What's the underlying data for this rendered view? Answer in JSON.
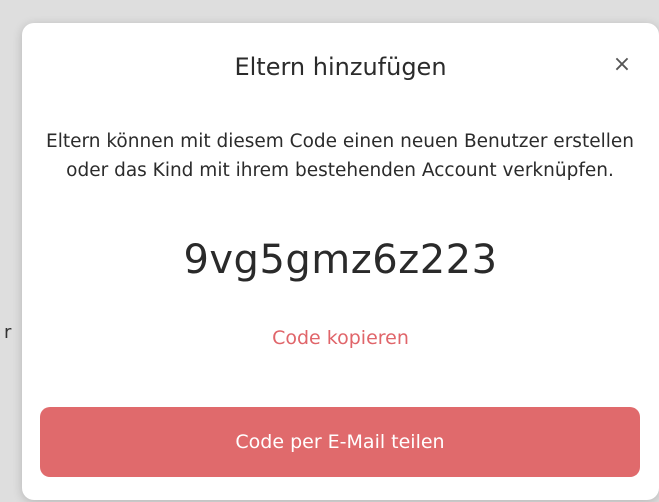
{
  "background": {
    "partial_text": "r"
  },
  "dialog": {
    "title": "Eltern hinzufügen",
    "close_glyph": "×",
    "description": "Eltern können mit diesem Code einen neuen Benutzer erstellen oder das Kind mit ihrem bestehenden Account verknüpfen.",
    "code": "9vg5gmz6z223",
    "copy_label": "Code kopieren",
    "share_label": "Code per E-Mail teilen"
  },
  "colors": {
    "accent": "#e06a6c",
    "link": "#e0656a",
    "text": "#2b2b2b",
    "backdrop": "#dedede"
  },
  "icons": {
    "close": "close-icon"
  }
}
